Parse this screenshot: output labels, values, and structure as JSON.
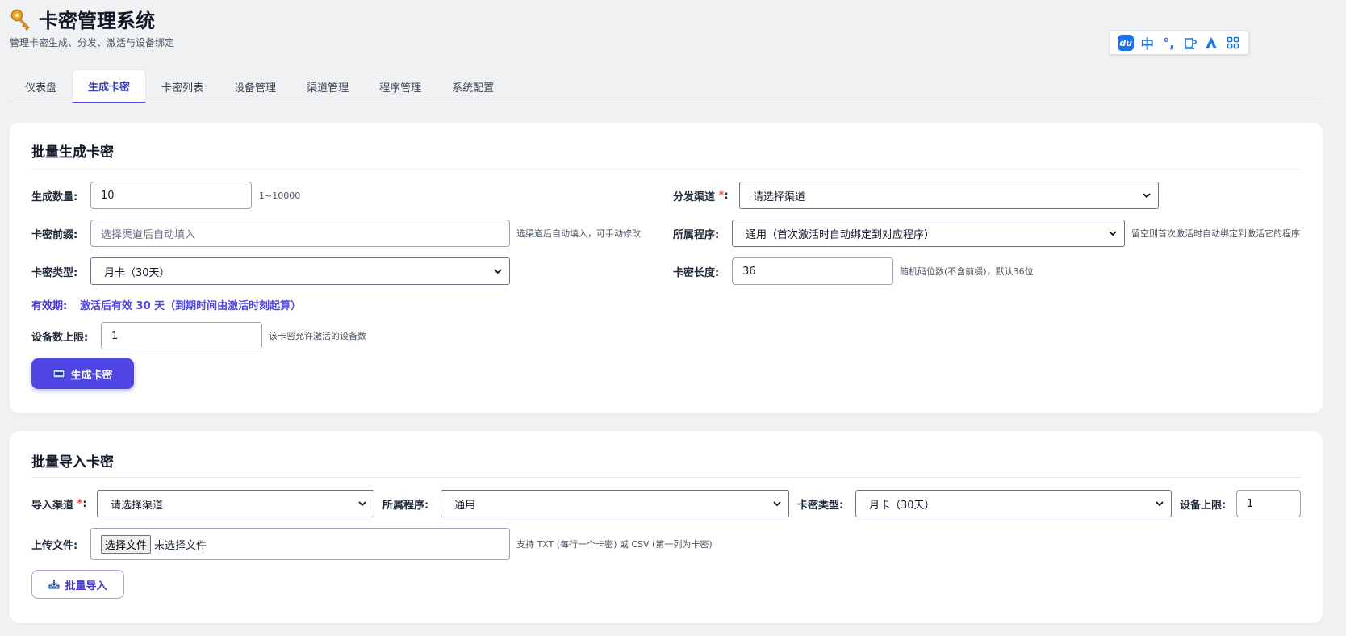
{
  "app": {
    "title": "卡密管理系统",
    "subtitle": "管理卡密生成、分发、激活与设备绑定"
  },
  "ime_toolbar": {
    "items": [
      "du",
      "中",
      "°,",
      "cup",
      "A",
      "grid"
    ]
  },
  "tabs": [
    {
      "label": "仪表盘",
      "active": false
    },
    {
      "label": "生成卡密",
      "active": true
    },
    {
      "label": "卡密列表",
      "active": false
    },
    {
      "label": "设备管理",
      "active": false
    },
    {
      "label": "渠道管理",
      "active": false
    },
    {
      "label": "程序管理",
      "active": false
    },
    {
      "label": "系统配置",
      "active": false
    }
  ],
  "generate": {
    "title": "批量生成卡密",
    "quantity": {
      "label": "生成数量:",
      "value": "10",
      "hint": "1~10000"
    },
    "channel": {
      "label": "分发渠道",
      "required_mark": "*",
      "colon": ":",
      "value": "请选择渠道"
    },
    "prefix": {
      "label": "卡密前缀:",
      "placeholder": "选择渠道后自动填入",
      "hint": "选渠道后自动填入，可手动修改"
    },
    "program": {
      "label": "所属程序:",
      "value": "通用（首次激活时自动绑定到对应程序）",
      "hint": "留空则首次激活时自动绑定到激活它的程序"
    },
    "type": {
      "label": "卡密类型:",
      "value": "月卡（30天）"
    },
    "length": {
      "label": "卡密长度:",
      "value": "36",
      "hint": "随机码位数(不含前缀)，默认36位"
    },
    "validity": {
      "label": "有效期:",
      "value": "激活后有效 30 天（到期时间由激活时刻起算）"
    },
    "device_limit": {
      "label": "设备数上限:",
      "value": "1",
      "hint": "该卡密允许激活的设备数"
    },
    "submit_label": "生成卡密"
  },
  "import": {
    "title": "批量导入卡密",
    "channel": {
      "label": "导入渠道",
      "required_mark": "*",
      "colon": ":",
      "value": "请选择渠道"
    },
    "program": {
      "label": "所属程序:",
      "value": "通用"
    },
    "type": {
      "label": "卡密类型:",
      "value": "月卡（30天）"
    },
    "device_limit": {
      "label": "设备上限:",
      "value": "1"
    },
    "file": {
      "label": "上传文件:",
      "button": "选择文件",
      "status": "未选择文件",
      "hint": "支持 TXT (每行一个卡密) 或 CSV (第一列为卡密)"
    },
    "submit_label": "批量导入"
  },
  "colors": {
    "accent": "#4f46e5",
    "required": "#ef4444",
    "background": "#f0f1f3"
  }
}
